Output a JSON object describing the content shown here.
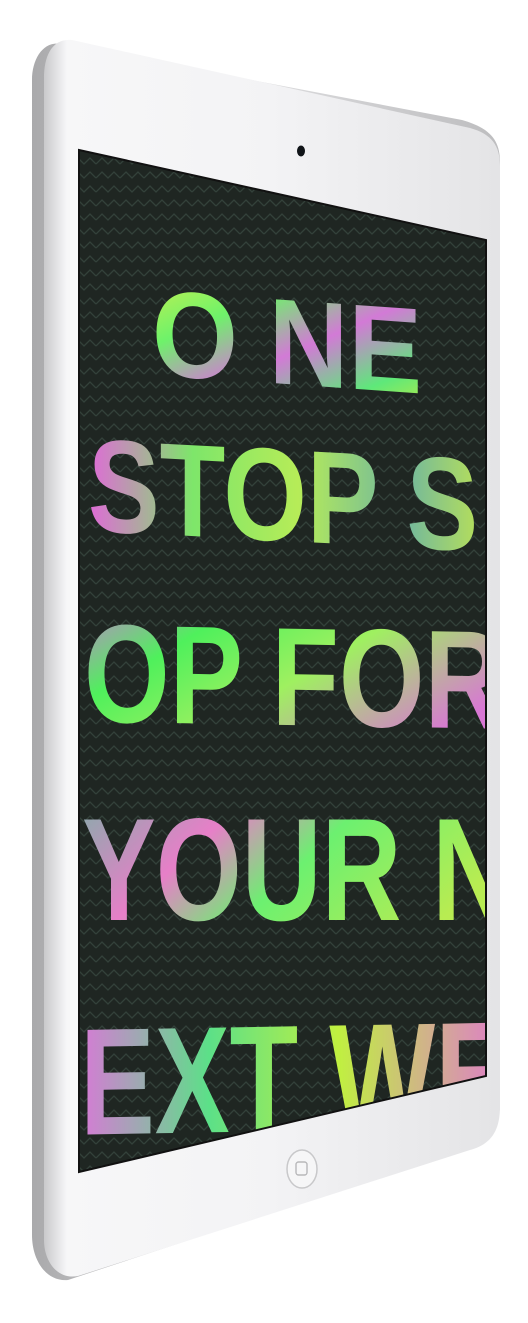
{
  "device": {
    "kind": "tablet",
    "orientation": "portrait",
    "color": "silver-white"
  },
  "screen": {
    "background_color": "#1f2622",
    "pattern": "zigzag-chevron",
    "lines": [
      "O NE",
      "STOP SI",
      "OP FOR",
      "YOUR N",
      "EXT WE"
    ]
  },
  "icons": {
    "home_button": "home-button-icon",
    "camera": "front-camera-icon"
  }
}
